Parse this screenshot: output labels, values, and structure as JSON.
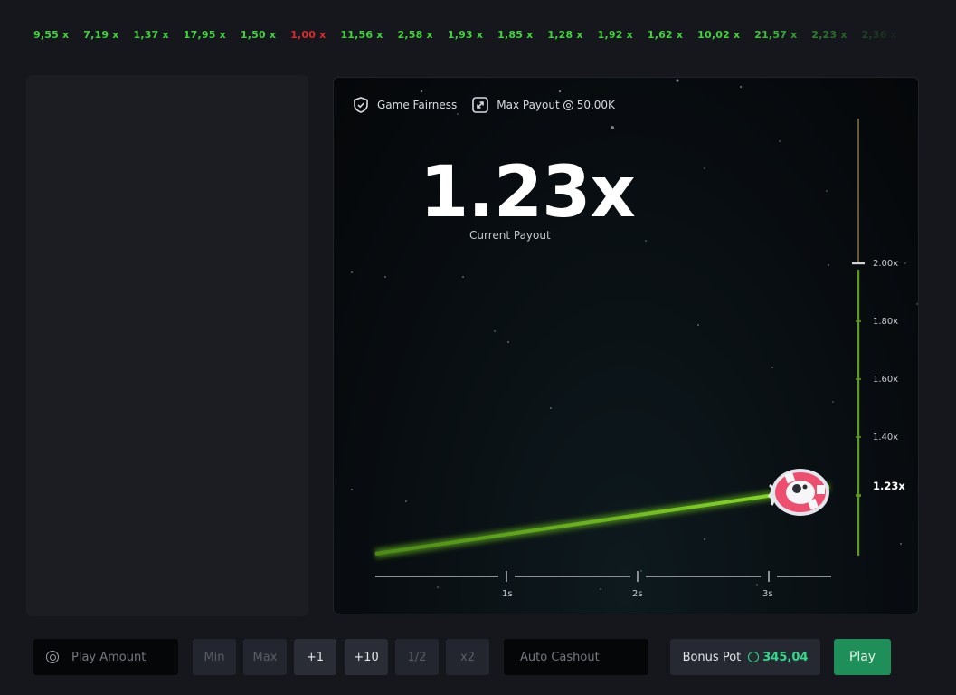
{
  "history": [
    {
      "value": "9,55 x",
      "color": "#3fd23a"
    },
    {
      "value": "7,19 x",
      "color": "#3fd23a"
    },
    {
      "value": "1,37 x",
      "color": "#3fd23a"
    },
    {
      "value": "17,95 x",
      "color": "#3fd23a"
    },
    {
      "value": "1,50 x",
      "color": "#3fd23a"
    },
    {
      "value": "1,00 x",
      "color": "#d62b2b"
    },
    {
      "value": "11,56 x",
      "color": "#3fd23a"
    },
    {
      "value": "2,58 x",
      "color": "#3fd23a"
    },
    {
      "value": "1,93 x",
      "color": "#3fd23a"
    },
    {
      "value": "1,85 x",
      "color": "#3fd23a"
    },
    {
      "value": "1,28 x",
      "color": "#3fd23a"
    },
    {
      "value": "1,92 x",
      "color": "#3fd23a"
    },
    {
      "value": "1,62 x",
      "color": "#3fd23a"
    },
    {
      "value": "10,02 x",
      "color": "#3fd23a"
    },
    {
      "value": "21,57 x",
      "color": "#3fd23a"
    },
    {
      "value": "2,23 x",
      "color": "#3fd23a"
    },
    {
      "value": "2,36 x",
      "color": "#3fd23a"
    }
  ],
  "game": {
    "fairness_label": "Game Fairness",
    "max_payout_label": "Max Payout",
    "max_payout_value": "50,00K",
    "multiplier": "1.23x",
    "multiplier_label": "Current Payout",
    "scale": [
      "2.00x",
      "1.80x",
      "1.60x",
      "1.40x"
    ],
    "current_scale": "1.23x",
    "time_ticks": [
      "1s",
      "2s",
      "3s"
    ]
  },
  "controls": {
    "amount_placeholder": "Play Amount",
    "min": "Min",
    "max": "Max",
    "plus1": "+1",
    "plus10": "+10",
    "half": "1/2",
    "double": "x2",
    "auto_cashout": "Auto Cashout",
    "bonus_label": "Bonus Pot",
    "bonus_value": "345,04",
    "play": "Play"
  },
  "colors": {
    "accent_green": "#2fdc8b",
    "win": "#3fd23a",
    "loss": "#d62b2b",
    "play_button": "#1f8f59"
  }
}
